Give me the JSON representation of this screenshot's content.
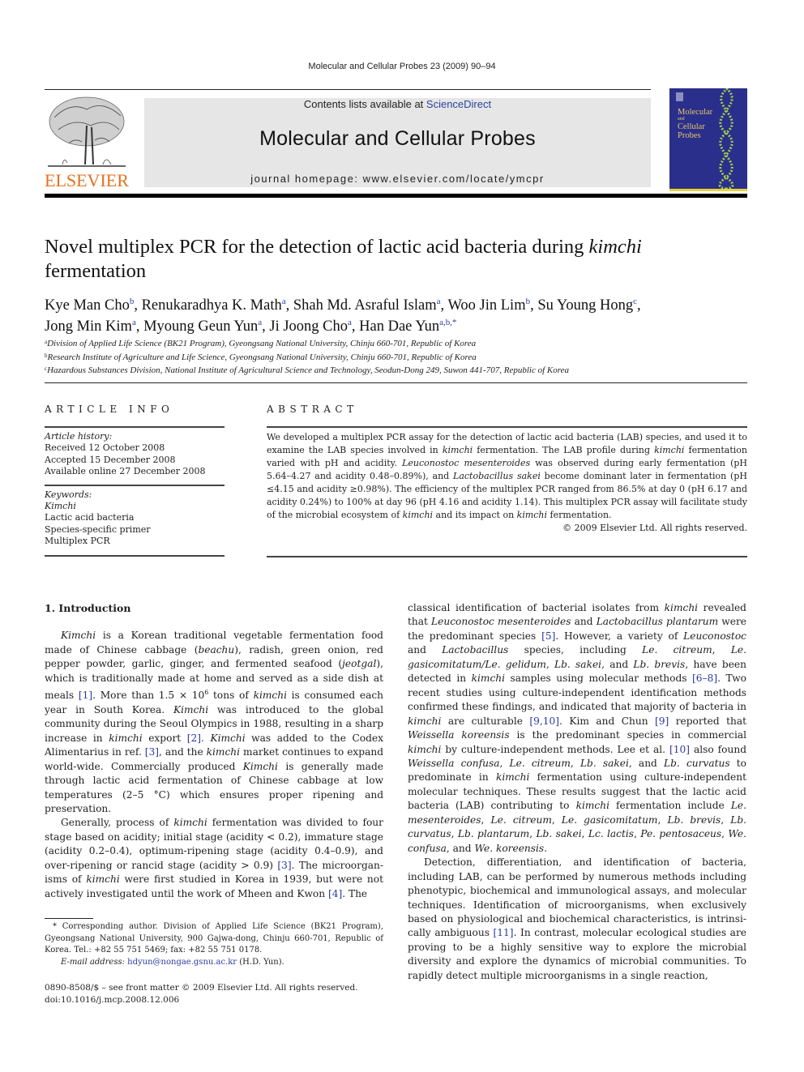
{
  "running_head": "Molecular and Cellular Probes 23 (2009) 90–94",
  "header": {
    "publisher_logo_text": "ELSEVIER",
    "contents_prefix": "Contents lists available at ",
    "contents_link": "ScienceDirect",
    "journal_name": "Molecular and Cellular Probes",
    "homepage": "journal homepage: www.elsevier.com/locate/ymcpr",
    "cover": {
      "title_lines": [
        "Molecular",
        "and",
        "Cellular",
        "Probes"
      ],
      "background_color": "#2a2f8c",
      "accent_color": "#e8d43a"
    },
    "logo_color": "#e7701e",
    "link_color": "#2a44a0"
  },
  "article": {
    "title_plain": "Novel multiplex PCR for the detection of lactic acid bacteria during ",
    "title_italic": "kimchi",
    "title_end": "fermentation",
    "authors": [
      {
        "name": "Kye Man Cho",
        "aff": "b"
      },
      {
        "name": "Renukaradhya K. Math",
        "aff": "a"
      },
      {
        "name": "Shah Md. Asraful Islam",
        "aff": "a"
      },
      {
        "name": "Woo Jin Lim",
        "aff": "b"
      },
      {
        "name": "Su Young Hong",
        "aff": "c"
      },
      {
        "name": "Jong Min Kim",
        "aff": "a"
      },
      {
        "name": "Myoung Geun Yun",
        "aff": "a"
      },
      {
        "name": "Ji Joong Cho",
        "aff": "a"
      },
      {
        "name": "Han Dae Yun",
        "aff": "a,b,*"
      }
    ],
    "affiliations": [
      {
        "key": "a",
        "text": "Division of Applied Life Science (BK21 Program), Gyeongsang National University, Chinju 660-701, Republic of Korea"
      },
      {
        "key": "b",
        "text": "Research Institute of Agriculture and Life Science, Gyeongsang National University, Chinju 660-701, Republic of Korea"
      },
      {
        "key": "c",
        "text": "Hazardous Substances Division, National Institute of Agricultural Science and Technology, Seodun-Dong 249, Suwon 441-707, Republic of Korea"
      }
    ]
  },
  "article_info": {
    "heading": "ARTICLE INFO",
    "history_label": "Article history:",
    "history": [
      "Received 12 October 2008",
      "Accepted 15 December 2008",
      "Available online 27 December 2008"
    ],
    "keywords_label": "Keywords:",
    "keywords": [
      "Kimchi",
      "Lactic acid bacteria",
      "Species-specific primer",
      "Multiplex PCR"
    ]
  },
  "abstract": {
    "heading": "ABSTRACT",
    "segments": [
      {
        "t": "We developed a multiplex PCR assay for the detection of lactic acid bacteria (LAB) species, and used it to examine the LAB species involved in "
      },
      {
        "t": "kimchi",
        "i": true
      },
      {
        "t": " fermentation. The LAB profile during "
      },
      {
        "t": "kimchi",
        "i": true
      },
      {
        "t": " fermentation varied with pH and acidity. "
      },
      {
        "t": "Leuconostoc mesenteroides",
        "i": true
      },
      {
        "t": " was observed during early fermentation (pH 5.64–4.27 and acidity 0.48–0.89%), and "
      },
      {
        "t": "Lactobacillus sakei",
        "i": true
      },
      {
        "t": " become dominant later in fermentation (pH ≤4.15 and acidity ≥0.98%). The efficiency of the multiplex PCR ranged from 86.5% at day 0 (pH 6.17 and acidity 0.24%) to 100% at day 96 (pH 4.16 and acidity 1.14). This multiplex PCR assay will facilitate study of the microbial ecosystem of "
      },
      {
        "t": "kimchi",
        "i": true
      },
      {
        "t": " and its impact on "
      },
      {
        "t": "kimchi",
        "i": true
      },
      {
        "t": " fermentation."
      }
    ],
    "copyright": "© 2009 Elsevier Ltd. All rights reserved."
  },
  "body": {
    "section_heading": "1.  Introduction",
    "left_paragraphs": [
      [
        {
          "t": "Kimchi",
          "i": true
        },
        {
          "t": " is a Korean traditional vegetable fermentation food made of Chinese cabbage ("
        },
        {
          "t": "beachu",
          "i": true
        },
        {
          "t": "), radish, green onion, red pepper powder, garlic, ginger, and fermented seafood ("
        },
        {
          "t": "jeotgal",
          "i": true
        },
        {
          "t": "), which is traditionally made at home and served as a side dish at meals "
        },
        {
          "t": "[1]",
          "r": true
        },
        {
          "t": ". More than 1.5 × 10"
        },
        {
          "t": "6",
          "sup": true
        },
        {
          "t": " tons of "
        },
        {
          "t": "kimchi",
          "i": true
        },
        {
          "t": " is consumed each year in South Korea. "
        },
        {
          "t": "Kimchi",
          "i": true
        },
        {
          "t": " was introduced to the global community during the Seoul Olympics in 1988, resulting in a sharp increase in "
        },
        {
          "t": "kimchi",
          "i": true
        },
        {
          "t": " export "
        },
        {
          "t": "[2]",
          "r": true
        },
        {
          "t": ". "
        },
        {
          "t": "Kimchi",
          "i": true
        },
        {
          "t": " was added to the Codex Alimentarius in ref. "
        },
        {
          "t": "[3]",
          "r": true
        },
        {
          "t": ", and the "
        },
        {
          "t": "kimchi",
          "i": true
        },
        {
          "t": " market continues to expand world-wide. Commercially produced "
        },
        {
          "t": "Kimchi",
          "i": true
        },
        {
          "t": " is generally made through lactic acid fermentation of Chinese cabbage at low temperatures (2–5 °C) which ensures proper ripening and preservation."
        }
      ],
      [
        {
          "t": "Generally, process of "
        },
        {
          "t": "kimchi",
          "i": true
        },
        {
          "t": " fermentation was divided to four stage based on acidity; initial stage (acidity < 0.2), immature stage (acidity 0.2–0.4), optimum-ripening stage (acidity 0.4–0.9), and over-ripening or rancid stage (acidity > 0.9) "
        },
        {
          "t": "[3]",
          "r": true
        },
        {
          "t": ". The microorgan­isms of "
        },
        {
          "t": "kimchi",
          "i": true
        },
        {
          "t": " were first studied in Korea in 1939, but were not actively investigated until the work of Mheen and Kwon "
        },
        {
          "t": "[4]",
          "r": true
        },
        {
          "t": ". The"
        }
      ]
    ],
    "right_paragraphs": [
      [
        {
          "t": "classical identification of bacterial isolates from "
        },
        {
          "t": "kimchi",
          "i": true
        },
        {
          "t": " revealed that "
        },
        {
          "t": "Leuconostoc mesenteroides",
          "i": true
        },
        {
          "t": " and "
        },
        {
          "t": "Lactobacillus plantarum",
          "i": true
        },
        {
          "t": " were the predominant species "
        },
        {
          "t": "[5]",
          "r": true
        },
        {
          "t": ". However, a variety of "
        },
        {
          "t": "Leuconostoc",
          "i": true
        },
        {
          "t": " and "
        },
        {
          "t": "Lactobacillus",
          "i": true
        },
        {
          "t": " species, including "
        },
        {
          "t": "Le. citreum",
          "i": true
        },
        {
          "t": ", "
        },
        {
          "t": "Le. gasicomitatum/Le. gelidum",
          "i": true
        },
        {
          "t": ", "
        },
        {
          "t": "Lb. sakei",
          "i": true
        },
        {
          "t": ", and "
        },
        {
          "t": "Lb. brevis",
          "i": true
        },
        {
          "t": ", have been detected in "
        },
        {
          "t": "kimchi",
          "i": true
        },
        {
          "t": " samples using molecular methods "
        },
        {
          "t": "[6–8]",
          "r": true
        },
        {
          "t": ". Two recent studies using culture-independent identification methods confirmed these findings, and indicated that majority of bacteria in "
        },
        {
          "t": "kimchi",
          "i": true
        },
        {
          "t": " are cul­turable "
        },
        {
          "t": "[9,10]",
          "r": true
        },
        {
          "t": ". Kim and Chun "
        },
        {
          "t": "[9]",
          "r": true
        },
        {
          "t": " reported that "
        },
        {
          "t": "Weissella koreensis",
          "i": true
        },
        {
          "t": " is the predominant species in commercial "
        },
        {
          "t": "kimchi",
          "i": true
        },
        {
          "t": " by culture-inde­pendent methods. Lee et al. "
        },
        {
          "t": "[10]",
          "r": true
        },
        {
          "t": " also found "
        },
        {
          "t": "Weissella confusa",
          "i": true
        },
        {
          "t": ", "
        },
        {
          "t": "Le. citreum",
          "i": true
        },
        {
          "t": ", "
        },
        {
          "t": "Lb. sakei",
          "i": true
        },
        {
          "t": ", and "
        },
        {
          "t": "Lb. curvatus",
          "i": true
        },
        {
          "t": " to predominate in "
        },
        {
          "t": "kimchi",
          "i": true
        },
        {
          "t": " fermentation using culture-independent molecular techniques. These results suggest that the lactic acid bacteria (LAB) contributing to "
        },
        {
          "t": "kimchi",
          "i": true
        },
        {
          "t": " fermentation include "
        },
        {
          "t": "Le. mesenteroides",
          "i": true
        },
        {
          "t": ", "
        },
        {
          "t": "Le. citreum",
          "i": true
        },
        {
          "t": ", "
        },
        {
          "t": "Le. gasicomitatum",
          "i": true
        },
        {
          "t": ", "
        },
        {
          "t": "Lb. brevis",
          "i": true
        },
        {
          "t": ", "
        },
        {
          "t": "Lb. curvatus",
          "i": true
        },
        {
          "t": ", "
        },
        {
          "t": "Lb. plantarum",
          "i": true
        },
        {
          "t": ", "
        },
        {
          "t": "Lb. sakei",
          "i": true
        },
        {
          "t": ", "
        },
        {
          "t": "Lc. lactis",
          "i": true
        },
        {
          "t": ", "
        },
        {
          "t": "Pe. pentosaceus",
          "i": true
        },
        {
          "t": ", "
        },
        {
          "t": "We. confusa",
          "i": true
        },
        {
          "t": ", and "
        },
        {
          "t": "We. koreensis",
          "i": true
        },
        {
          "t": "."
        }
      ],
      [
        {
          "t": "Detection, differentiation, and identification of bacteria, including LAB, can be performed by numerous methods including phenotypic, biochemical and immunological assays, and molecular techniques. Identification of microorganisms, when exclusively based on physiological and biochemical characteristics, is intrinsi­cally ambiguous "
        },
        {
          "t": "[11]",
          "r": true
        },
        {
          "t": ". In contrast, molecular ecological studies are proving to be a highly sensitive way to explore the microbial diversity and explore the dynamics of microbial communities. To rapidly detect multiple microorganisms in a single reaction,"
        }
      ]
    ]
  },
  "footnote": {
    "corresponding": "* Corresponding author. Division of Applied Life Science (BK21 Program), Gyeongsang National University, 900 Gajwa-dong, Chinju 660-701, Republic of Korea. Tel.: +82 55 751 5469; fax: +82 55 751 0178.",
    "email_label": "E-mail address:",
    "email": "hdyun@nongae.gsnu.ac.kr",
    "email_suffix": " (H.D. Yun)."
  },
  "front_matter": {
    "issn_line": "0890-8508/$ – see front matter © 2009 Elsevier Ltd. All rights reserved.",
    "doi": "doi:10.1016/j.mcp.2008.12.006"
  }
}
